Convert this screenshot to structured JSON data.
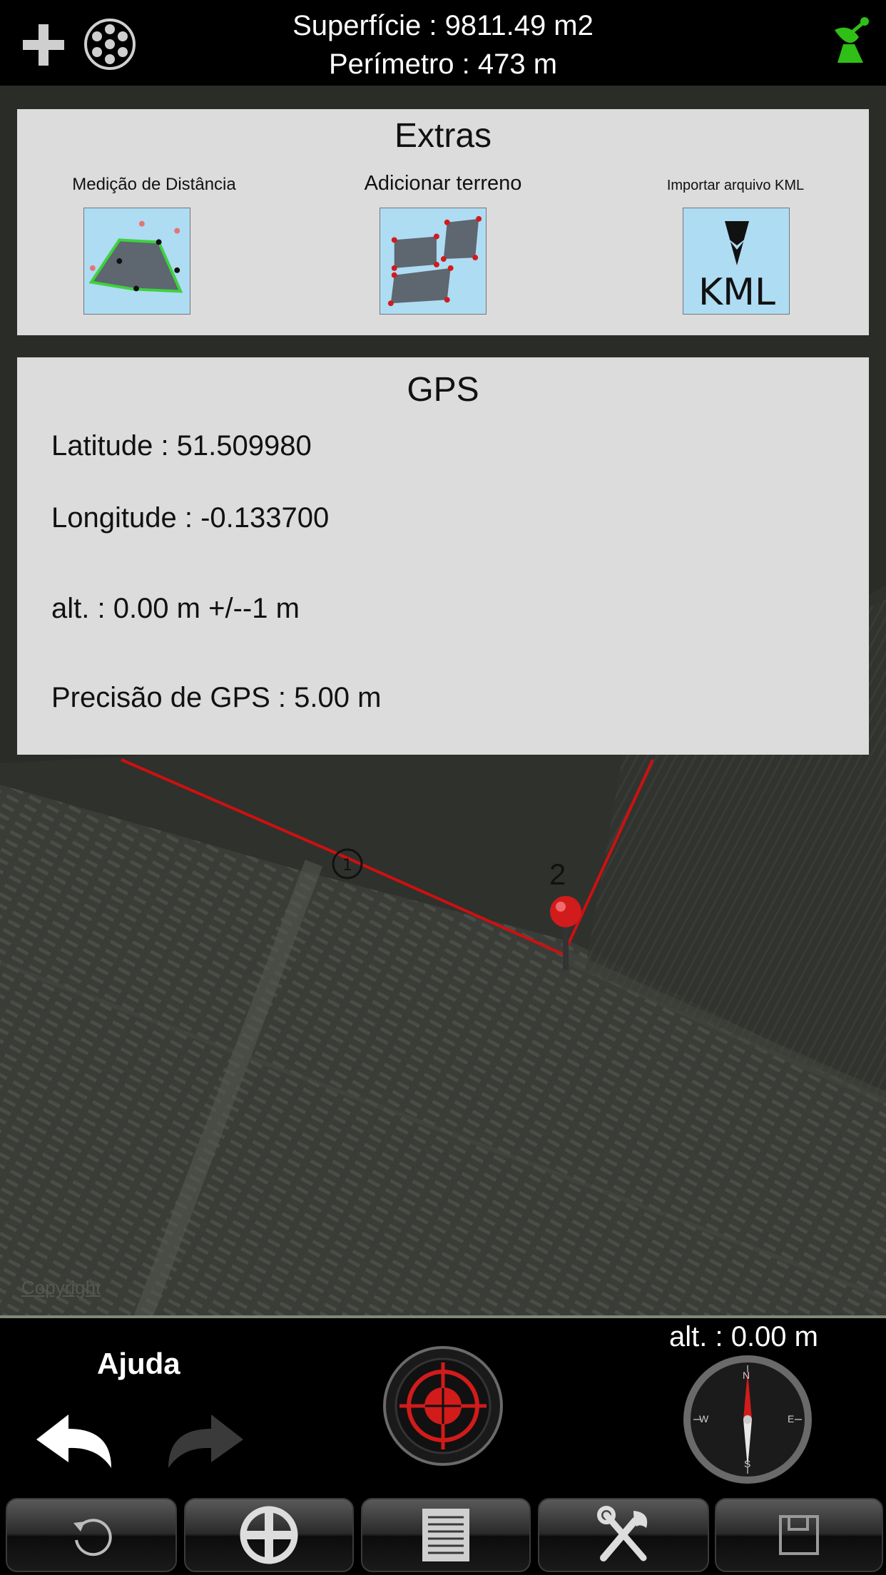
{
  "header": {
    "surface": "Superfície : 9811.49 m2",
    "perimeter": "Perímetro : 473 m",
    "icons": [
      "plus-icon",
      "film-reel-icon",
      "satellite-dish-icon"
    ]
  },
  "extras": {
    "title": "Extras",
    "items": [
      {
        "label": "Medição de Distância",
        "icon": "distance-measure-icon"
      },
      {
        "label": "Adicionar terreno",
        "icon": "add-terrain-icon"
      },
      {
        "label": "Importar arquivo KML",
        "icon": "kml-import-icon",
        "tile_text": "KML"
      }
    ]
  },
  "gps": {
    "title": "GPS",
    "latitude": "Latitude : 51.509980",
    "longitude": "Longitude : -0.133700",
    "altitude": "alt. : 0.00 m +/--1 m",
    "precision": "Precisão de GPS : 5.00 m"
  },
  "map": {
    "copyright": "Copyright",
    "pin_number": "2",
    "boundary_color": "#cc1111"
  },
  "bottom": {
    "help": "Ajuda",
    "altitude": "alt. : 0.00 m",
    "compass_labels": [
      "N",
      "E",
      "S",
      "W"
    ],
    "toolbar": [
      "refresh-icon",
      "crosshair-icon",
      "list-icon",
      "tools-icon",
      "save-icon"
    ]
  },
  "colors": {
    "panel_bg": "#dcdcdc",
    "accent_green": "#2fbf16",
    "accent_red": "#d21b1b"
  }
}
